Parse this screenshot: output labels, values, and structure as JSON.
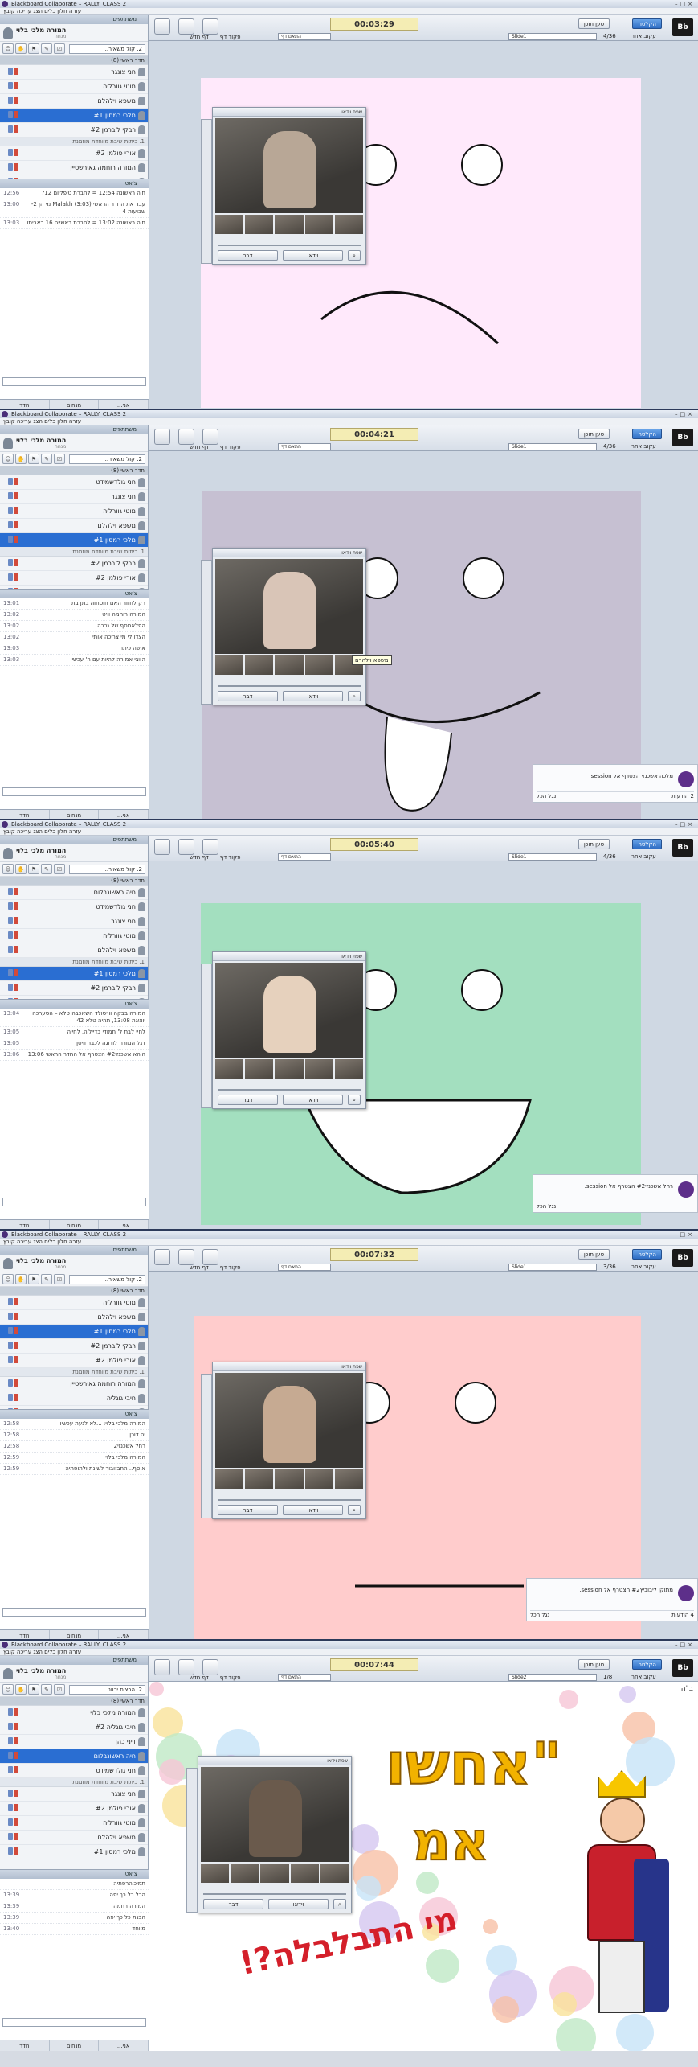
{
  "app": {
    "title": "Blackboard Collaborate – RALLY: CLASS 2",
    "menu": "עזרה  חלון  כלים  הצג  עריכה  קובץ"
  },
  "panels": {
    "participants": "משתתפים",
    "chat": "צ'אט"
  },
  "moderator": {
    "name": "המורה מלכי בלוי",
    "role": "מנחה"
  },
  "toolbar": {
    "dropdown": "2. קול משאיר...",
    "dropdown5": "2. הרצים יכוונ...",
    "load": "טען תוכן",
    "record": "הקלטה",
    "follow": "עקוב אחר",
    "new_page": "דף חדש",
    "page_cmd": "פקוד דף",
    "fit_page": "התאם דף",
    "slide": "Slide1",
    "slide5": "Slide2",
    "logo": "Bb"
  },
  "groups": {
    "main": "חדר ראשי (8)",
    "room1": "1. כיתות שיבת מיוחדת מוזמנת",
    "room2": "2. כיתות שיבת מיוחדת - ארוצה"
  },
  "video": {
    "title": "שפת וידאו",
    "talk": "דבר",
    "video": "וידאו",
    "tooltip": "משפא וילהרם"
  },
  "tabs": {
    "t1": "חדר",
    "t2": "מנחים",
    "t3": "אני...",
    "bottom": "מכל הכל",
    "mine": "נגל הכל"
  },
  "shots": [
    {
      "timer": "00:03:29",
      "page": "4/36",
      "participants": [
        {
          "name": "חני צונגר"
        },
        {
          "name": "מוטי גוורליה"
        },
        {
          "name": "משפא וילהלם"
        },
        {
          "name": "מלכי רמסון #1",
          "sel": true
        },
        {
          "name": "רבקי ליברמן #2"
        },
        {
          "name": "אורי פולמן #2"
        },
        {
          "name": "המורה רוחמה גאירשטיין"
        },
        {
          "name": "חיבי גוגליה"
        }
      ],
      "chat": [
        {
          "text": "חיה ראשונה 12:54 = לחברת טיפליום 12?",
          "time": "12:56"
        },
        {
          "text": "עבר את החדר הראשי Malakh (3:03) מי הן 2-שבועות 4",
          "time": "13:00"
        },
        {
          "text": "חיה ראשונה 13:02 = לחברת ראשייה 16 ראביתו",
          "time": "13:03"
        }
      ]
    },
    {
      "timer": "00:04:21",
      "page": "4/36",
      "participants": [
        {
          "name": "חני גולדשמידט"
        },
        {
          "name": "חני צונגר"
        },
        {
          "name": "מוטי גוורליה"
        },
        {
          "name": "משפא וילהלם"
        },
        {
          "name": "מלכי רמסון #1",
          "sel": true
        },
        {
          "name": "רבקי ליברמן #2"
        },
        {
          "name": "אורי פולמן #2"
        },
        {
          "name": "המורה רוחמה גאירשטיין"
        }
      ],
      "chat": [
        {
          "text": "רק לחזור האם חוטחוה בתן בת",
          "time": "13:01"
        },
        {
          "text": "המורה רוחמה וויט",
          "time": "13:02"
        },
        {
          "text": "הפלאמסף של נכבה",
          "time": "13:02"
        },
        {
          "text": "הצדו לי מי צריכה אותי",
          "time": "13:02"
        },
        {
          "text": "אישה כיתה",
          "time": "13:03"
        },
        {
          "text": "היוצי אמורה להיות עם ה' עכשיו",
          "time": "13:03"
        }
      ],
      "notif": "מלכה אשכנזי הצטרף אל session.",
      "count": "2 הודעות"
    },
    {
      "timer": "00:05:40",
      "page": "4/36",
      "participants": [
        {
          "name": "חיה ראשונבלום"
        },
        {
          "name": "חני גולדשמידט"
        },
        {
          "name": "חני צונגר"
        },
        {
          "name": "מוטי גוורליה"
        },
        {
          "name": "משפא וילהלם"
        },
        {
          "name": "מלכי רמסון #1",
          "sel": true
        },
        {
          "name": "רבקי ליברמן #2"
        },
        {
          "name": "אורי פולמן #2"
        }
      ],
      "chat": [
        {
          "text": "המורה בבקה ווייסולד השאכבה טלא – הסערכה יוצאת 13:08, תהיה טלא 42",
          "time": "13:04"
        },
        {
          "text": "לחיי לבת ל' חמודי בדייליה, לחייה",
          "time": "13:05"
        },
        {
          "text": "דגל המורה לודוגה לכבר וויטן",
          "time": "13:05"
        },
        {
          "text": "היהא אשכנזי#2 הצטרף אל החדר הראשי 13:06",
          "time": "13:06"
        }
      ],
      "notif": "רחל אשכנזי#2 הצטרף אל session.",
      "count": ""
    },
    {
      "timer": "00:07:32",
      "page": "3/36",
      "participants": [
        {
          "name": "מוטי גוורליה"
        },
        {
          "name": "משפא וילהלם"
        },
        {
          "name": "מלכי רמסון #1",
          "sel": true
        },
        {
          "name": "רבקי ליברמן #2"
        },
        {
          "name": "אורי פולמן #2"
        },
        {
          "name": "המורה רוחמה גאירשטיין"
        },
        {
          "name": "חיבי גוגליה"
        },
        {
          "name": "אסתי וילהלם"
        }
      ],
      "chat": [
        {
          "text": "המורה מלכי בלוי: ...לא לגעת עכשיו",
          "time": "12:58"
        },
        {
          "text": "יה דוכן",
          "time": "12:58"
        },
        {
          "text": "רחל אשכנזי2",
          "time": "12:58"
        },
        {
          "text": "המורה מלכי בלוי",
          "time": "12:59"
        },
        {
          "text": "אוסף.. החבזובוך לשונת ולתופתיה",
          "time": "12:59"
        }
      ],
      "notif": "מתוקן ליבוביץ#2 הצטרף אל session.",
      "count": "4 הודעות"
    },
    {
      "timer": "00:07:44",
      "page": "1/8",
      "participants": [
        {
          "name": "המורה מלכי בלוי"
        },
        {
          "name": "חיבי גוגליה #2"
        },
        {
          "name": "דיני כהן"
        },
        {
          "name": "חיה ראשונבלום",
          "sel": true
        },
        {
          "name": "חני גולדשמידט"
        },
        {
          "name": "חני צונגר"
        },
        {
          "name": "אורי פולמן #2"
        },
        {
          "name": "מוטי גוורליה"
        },
        {
          "name": "משפא וילהלם"
        },
        {
          "name": "מלכי רמסון #1"
        }
      ],
      "chat": [
        {
          "text": "תמיכיהרפתיה",
          "time": ""
        },
        {
          "text": "הכל כל כך יפה",
          "time": "13:39"
        },
        {
          "text": "המורה רחמה",
          "time": "13:39"
        },
        {
          "text": "הבנת כל כך יפה",
          "time": "13:39"
        },
        {
          "text": "מיוחד",
          "time": "13:40"
        }
      ],
      "slide": {
        "line1": "\"אחשו",
        "line2": "אמ",
        "line3": "מי התבלבלה?!",
        "corner": "ב\"ה"
      }
    }
  ]
}
